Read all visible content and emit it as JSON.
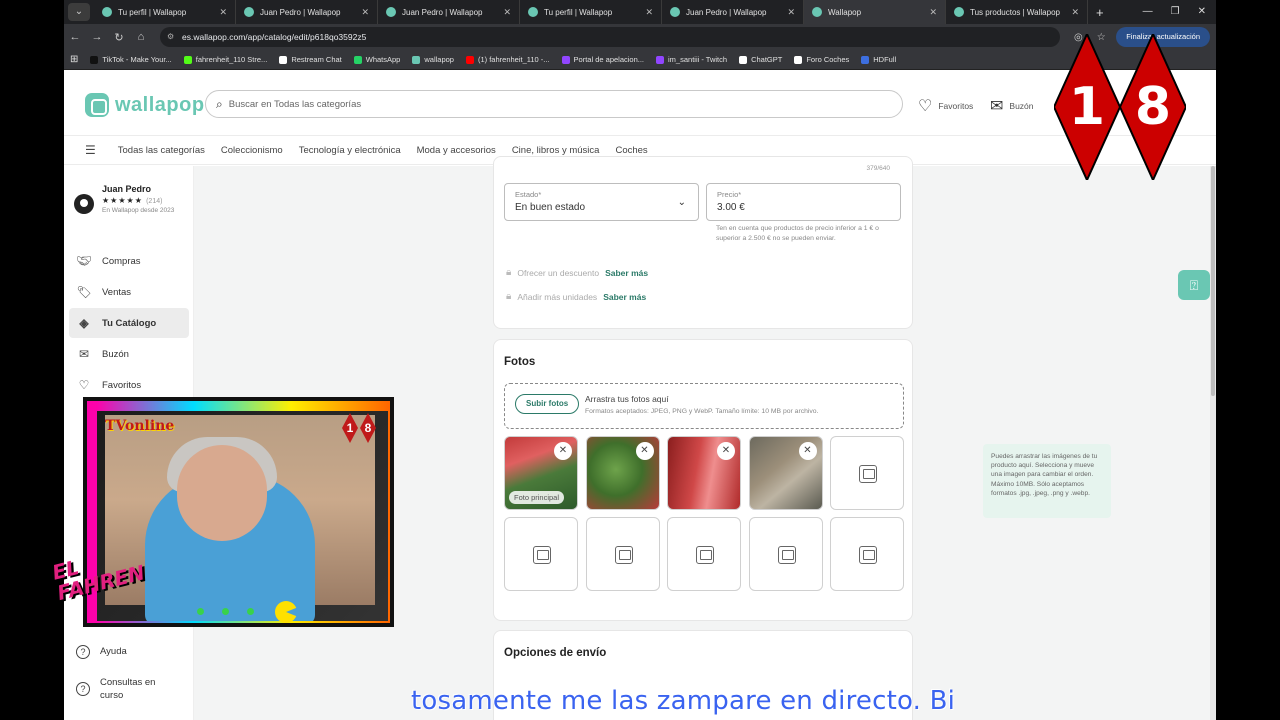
{
  "browser": {
    "tabs": [
      {
        "label": "Tu perfil | Wallapop",
        "active": false
      },
      {
        "label": "Juan Pedro | Wallapop",
        "active": false
      },
      {
        "label": "Juan Pedro | Wallapop",
        "active": false
      },
      {
        "label": "Tu perfil | Wallapop",
        "active": false
      },
      {
        "label": "Juan Pedro | Wallapop",
        "active": false
      },
      {
        "label": "Wallapop",
        "active": true
      },
      {
        "label": "Tus productos | Wallapop",
        "active": false
      }
    ],
    "url": "es.wallapop.com/app/catalog/edit/p618qo3592z5",
    "update_button": "Finalizar actualización",
    "bookmarks": [
      {
        "label": "TikTok - Make Your...",
        "color": "#111111"
      },
      {
        "label": "fahrenheit_110 Stre...",
        "color": "#53fc18"
      },
      {
        "label": "Restream Chat",
        "color": "#ffffff"
      },
      {
        "label": "WhatsApp",
        "color": "#25d366"
      },
      {
        "label": "wallapop",
        "color": "#6ac7b3"
      },
      {
        "label": "(1) fahrenheit_110 -...",
        "color": "#ff0000"
      },
      {
        "label": "Portal de apelacion...",
        "color": "#9146ff"
      },
      {
        "label": "im_santiii - Twitch",
        "color": "#9146ff"
      },
      {
        "label": "ChatGPT",
        "color": "#ffffff"
      },
      {
        "label": "Foro Coches",
        "color": "#ffffff"
      },
      {
        "label": "HDFull",
        "color": "#3d6fe0"
      }
    ]
  },
  "header": {
    "logo": "wallapop",
    "search_placeholder": "Buscar en Todas las categorías",
    "favoritos": "Favoritos",
    "buzon": "Buzón"
  },
  "categories": [
    "Todas las categorías",
    "Coleccionismo",
    "Tecnología y electrónica",
    "Moda y accesorios",
    "Cine, libros y música",
    "Coches"
  ],
  "sidebar": {
    "profile_name": "Juan Pedro",
    "stars": "★★★★★",
    "rating_count": "(214)",
    "member_since": "En Wallapop desde 2023",
    "items": [
      {
        "label": "Compras",
        "icon": "handshake-icon"
      },
      {
        "label": "Ventas",
        "icon": "tag-icon"
      },
      {
        "label": "Tu Catálogo",
        "icon": "catalog-icon",
        "active": true
      },
      {
        "label": "Buzón",
        "icon": "mail-icon"
      },
      {
        "label": "Favoritos",
        "icon": "heart-icon"
      }
    ],
    "bottom_items": [
      {
        "label": "Ayuda",
        "icon": "help-icon"
      },
      {
        "label": "Consultas en curso",
        "icon": "question-icon"
      }
    ]
  },
  "form": {
    "char_counter": "379/640",
    "estado_label": "Estado*",
    "estado_value": "En buen estado",
    "precio_label": "Precio*",
    "precio_value": "3.00 €",
    "price_note": "Ten en cuenta que productos de precio inferior a 1 € o superior a 2.500 € no se pueden enviar.",
    "discount_label": "Ofrecer un descuento",
    "units_label": "Añadir más unidades",
    "saber_mas": "Saber más"
  },
  "photos": {
    "title": "Fotos",
    "upload_button": "Subir fotos",
    "upload_hint": "Arrastra tus fotos aquí",
    "upload_formats": "Formatos aceptados: JPEG, PNG y WebP. Tamaño límite: 10 MB por archivo.",
    "main_photo_label": "Foto principal",
    "filled_count": 4,
    "tooltip": "Puedes arrastrar las imágenes de tu producto aquí. Selecciona y mueve una imagen para cambiar el orden. Máximo 10MB. Sólo aceptamos formatos .jpg, .jpeg, .png y .webp."
  },
  "shipping": {
    "title": "Opciones de envío"
  },
  "overlay": {
    "badge_digits": [
      "1",
      "8"
    ],
    "tv_label": "TV",
    "tv_online": "online",
    "brand_line1": "EL",
    "brand_line2": "FAHREN",
    "subtitle": "tosamente me las zampare en directo. Bi",
    "colors": {
      "accent": "#6ac7b3",
      "badge_red": "#cc0000",
      "subtitle": "#3a63f0"
    }
  }
}
